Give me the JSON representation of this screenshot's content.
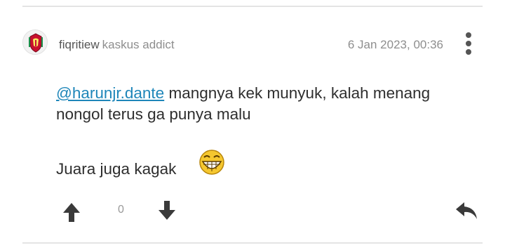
{
  "post": {
    "username": "fiqritiew",
    "rank": "kaskus addict",
    "timestamp": "6 Jan 2023, 00:36",
    "mention": "@harunjr.dante",
    "line1_rest": " mangnya kek munyuk, kalah menang",
    "line2": "nongol terus ga punya malu",
    "line3": "Juara juga kagak",
    "vote_count": "0"
  },
  "icons": {
    "avatar": "liverpool-crest-avatar",
    "more": "vertical-dots-icon",
    "emoji": "grinning-face-emoji",
    "upvote": "arrow-up-icon",
    "downvote": "arrow-down-icon",
    "reply": "reply-arrow-icon"
  },
  "colors": {
    "mention": "#1e86b9",
    "icon": "#3a3a3a",
    "meta_text": "#8e8e8e"
  }
}
